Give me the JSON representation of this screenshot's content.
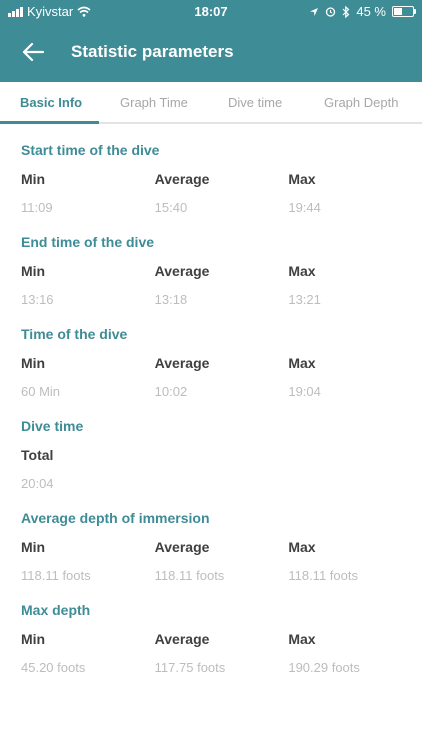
{
  "status_bar": {
    "carrier": "Kyivstar",
    "time": "18:07",
    "battery_text": "45 %",
    "battery_level": 0.45
  },
  "appbar": {
    "title": "Statistic parameters"
  },
  "tabs": [
    {
      "label": "Basic Info",
      "active": true
    },
    {
      "label": "Graph Time",
      "active": false
    },
    {
      "label": "Dive time",
      "active": false
    },
    {
      "label": "Graph Depth",
      "active": false
    }
  ],
  "sections": [
    {
      "title": "Start time of the dive",
      "stats": [
        {
          "label": "Min",
          "value": "11:09"
        },
        {
          "label": "Average",
          "value": "15:40"
        },
        {
          "label": "Max",
          "value": "19:44"
        }
      ]
    },
    {
      "title": "End time of the dive",
      "stats": [
        {
          "label": "Min",
          "value": "13:16"
        },
        {
          "label": "Average",
          "value": "13:18"
        },
        {
          "label": "Max",
          "value": "13:21"
        }
      ]
    },
    {
      "title": "Time of the dive",
      "stats": [
        {
          "label": "Min",
          "value": "60 Min"
        },
        {
          "label": "Average",
          "value": "10:02"
        },
        {
          "label": "Max",
          "value": "19:04"
        }
      ]
    },
    {
      "title": "Dive time",
      "stats": [
        {
          "label": "Total",
          "value": "20:04"
        }
      ]
    },
    {
      "title": "Average depth of immersion",
      "stats": [
        {
          "label": "Min",
          "value": "118.11 foots"
        },
        {
          "label": "Average",
          "value": "118.11 foots"
        },
        {
          "label": "Max",
          "value": "118.11 foots"
        }
      ]
    },
    {
      "title": "Max depth",
      "stats": [
        {
          "label": "Min",
          "value": "45.20 foots"
        },
        {
          "label": "Average",
          "value": "117.75 foots"
        },
        {
          "label": "Max",
          "value": "190.29 foots"
        }
      ]
    }
  ],
  "colors": {
    "primary": "#3e8c96",
    "label": "#404040",
    "value": "#bdbdbd",
    "tab_inactive": "#a7a7a7"
  }
}
